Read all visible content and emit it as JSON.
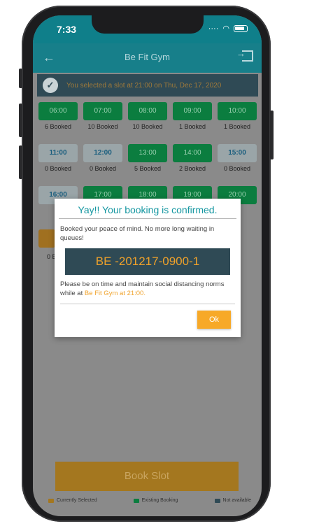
{
  "status_bar": {
    "time": "7:33"
  },
  "app_bar": {
    "title": "Be Fit Gym"
  },
  "selected_notice": "You selected a slot at 21:00 on Thu, Dec 17, 2020",
  "slots": [
    [
      {
        "time": "06:00",
        "booked": "6 Booked",
        "state": "existing"
      },
      {
        "time": "07:00",
        "booked": "10 Booked",
        "state": "existing"
      },
      {
        "time": "08:00",
        "booked": "10 Booked",
        "state": "existing"
      },
      {
        "time": "09:00",
        "booked": "1 Booked",
        "state": "existing"
      },
      {
        "time": "10:00",
        "booked": "1 Booked",
        "state": "existing"
      }
    ],
    [
      {
        "time": "11:00",
        "booked": "0 Booked",
        "state": "available"
      },
      {
        "time": "12:00",
        "booked": "0 Booked",
        "state": "available"
      },
      {
        "time": "13:00",
        "booked": "5 Booked",
        "state": "existing"
      },
      {
        "time": "14:00",
        "booked": "2 Booked",
        "state": "existing"
      },
      {
        "time": "15:00",
        "booked": "0 Booked",
        "state": "available"
      }
    ],
    [
      {
        "time": "16:00",
        "booked": "",
        "state": "available"
      },
      {
        "time": "17:00",
        "booked": "",
        "state": "existing"
      },
      {
        "time": "18:00",
        "booked": "",
        "state": "existing"
      },
      {
        "time": "19:00",
        "booked": "",
        "state": "existing"
      },
      {
        "time": "20:00",
        "booked": "",
        "state": "existing"
      }
    ]
  ],
  "partial_row_label": "0 B",
  "dialog": {
    "title": "Yay!! Your booking is confirmed.",
    "body": "Booked your peace of mind. No more long waiting in queues!",
    "code": "BE -201217-0900-1",
    "note_prefix": "Please be on time and maintain social distancing norms while at",
    "note_highlight": "Be Fit Gym at 21:00.",
    "ok_label": "Ok"
  },
  "book_button": "Book Slot",
  "legend": {
    "current": "Currently Selected",
    "existing": "Existing Booking",
    "not_available": "Not available"
  },
  "colors": {
    "accent": "#0f7f8a",
    "existing": "#0b7d3f",
    "selected": "#f7a928",
    "code_bg": "#2f4a55"
  },
  "icons": {
    "back": "arrow-left-icon",
    "exit": "exit-icon",
    "check": "check-circle-icon"
  }
}
